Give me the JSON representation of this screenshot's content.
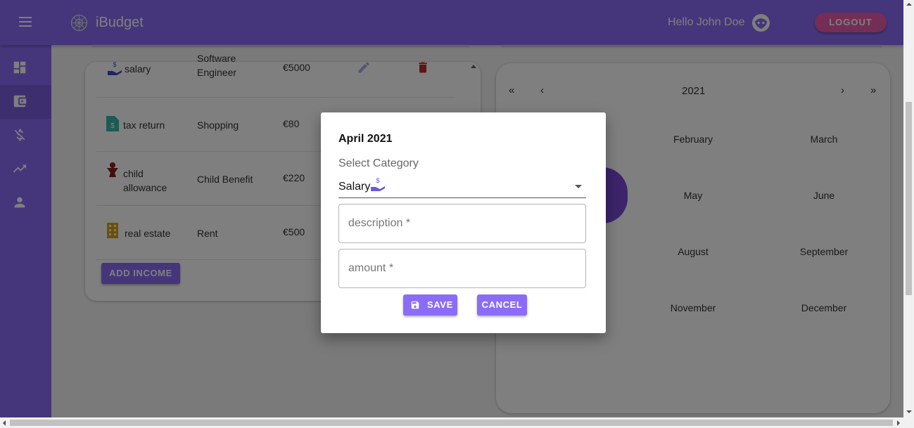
{
  "app": {
    "brand": "iBudget",
    "greeting": "Hello John Doe",
    "logout_label": "LOGOUT",
    "colors": {
      "primary": "#8b6cf6",
      "logout": "#e95dac",
      "delete": "#c62828",
      "selected_month": "#7a48d6"
    }
  },
  "sidebar": {
    "items": [
      {
        "name": "dashboard-icon"
      },
      {
        "name": "wallet-icon",
        "active": true
      },
      {
        "name": "money-off-icon"
      },
      {
        "name": "trending-up-icon"
      },
      {
        "name": "person-icon"
      }
    ]
  },
  "income_table": {
    "rows": [
      {
        "icon": "hand-coin-icon",
        "category": "salary",
        "description": "Software Engineer",
        "amount": "€5000"
      },
      {
        "icon": "receipt-icon",
        "category": "tax return",
        "description": "Shopping",
        "amount": "€80"
      },
      {
        "icon": "baby-icon",
        "category": "child allowance",
        "description": "Child Benefit",
        "amount": "€220"
      },
      {
        "icon": "building-icon",
        "category": "real estate",
        "description": "Rent",
        "amount": "€500"
      }
    ],
    "add_label": "ADD INCOME"
  },
  "calendar": {
    "first": "«",
    "prev": "‹",
    "year": "2021",
    "next": "›",
    "last": "»",
    "months": [
      "February",
      "March",
      "May",
      "June",
      "August",
      "September",
      "November",
      "December"
    ]
  },
  "dialog": {
    "title": "April 2021",
    "select_label": "Select Category",
    "selected_value": "Salary",
    "description_placeholder": "description *",
    "amount_placeholder": "amount *",
    "save_label": "SAVE",
    "cancel_label": "CANCEL"
  }
}
